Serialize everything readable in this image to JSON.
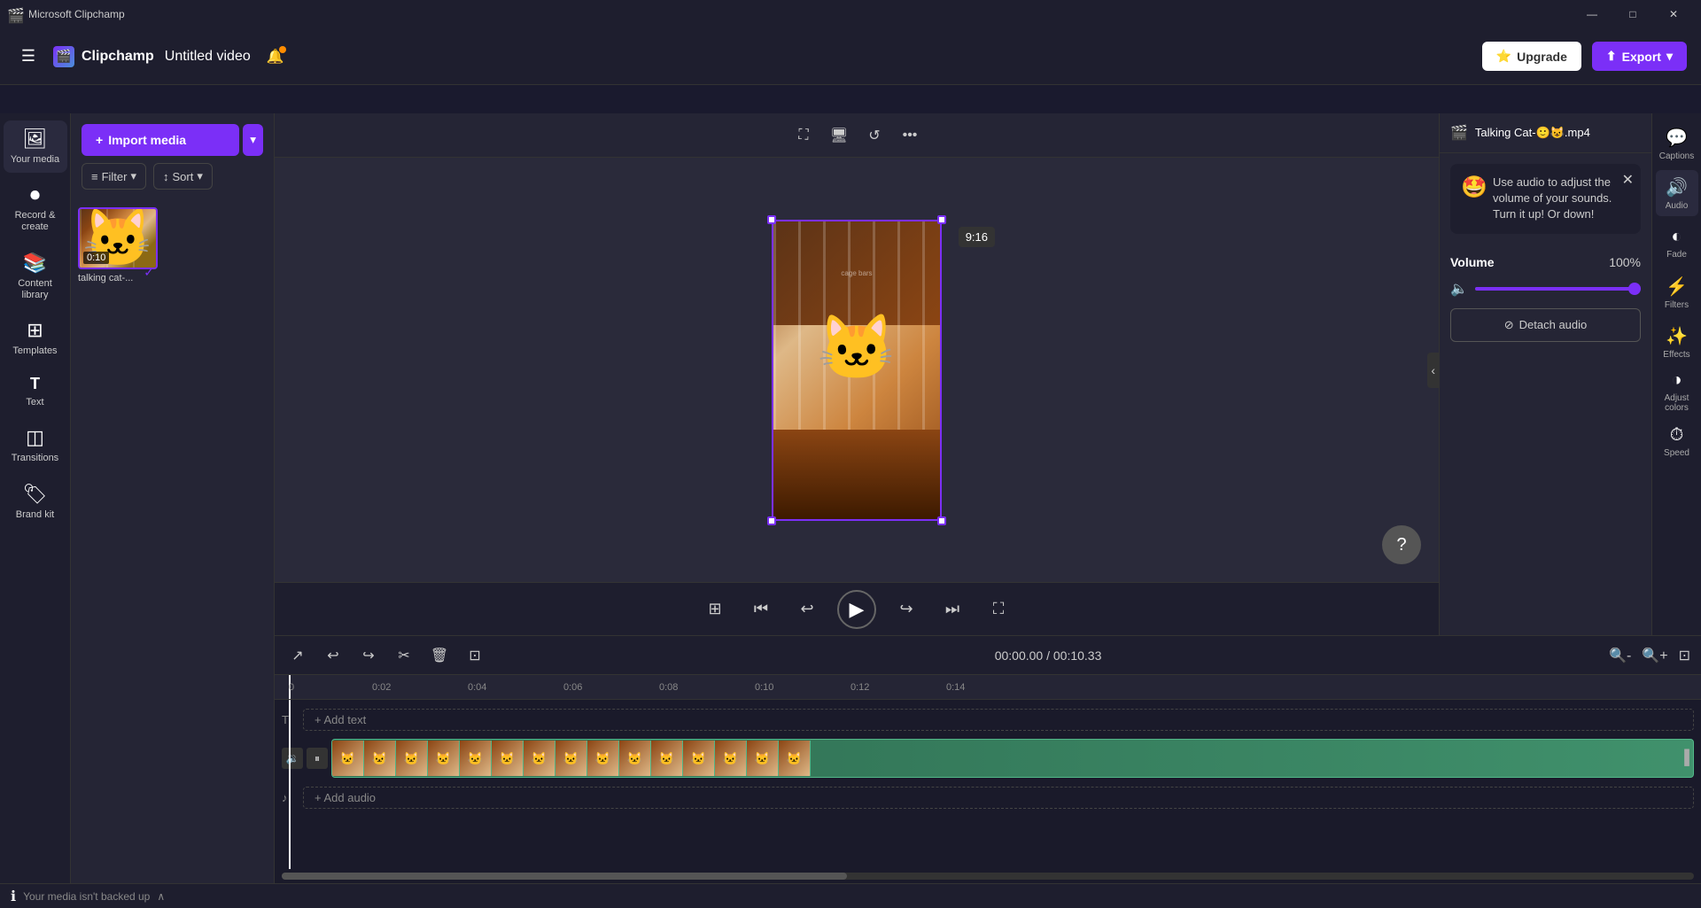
{
  "titlebar": {
    "title": "Microsoft Clipchamp",
    "controls": {
      "minimize": "—",
      "maximize": "□",
      "close": "✕"
    }
  },
  "topbar": {
    "brand_name": "Clipchamp",
    "video_title": "Untitled video",
    "upgrade_label": "Upgrade",
    "export_label": "Export"
  },
  "sidebar": {
    "items": [
      {
        "id": "your-media",
        "icon": "🖼",
        "label": "Your media"
      },
      {
        "id": "record-create",
        "icon": "⏺",
        "label": "Record & create"
      },
      {
        "id": "content-library",
        "icon": "📚",
        "label": "Content library"
      },
      {
        "id": "templates",
        "icon": "⊞",
        "label": "Templates"
      },
      {
        "id": "text",
        "icon": "T",
        "label": "Text"
      },
      {
        "id": "transitions",
        "icon": "◫",
        "label": "Transitions"
      },
      {
        "id": "brand-kit",
        "icon": "🏷",
        "label": "Brand kit"
      }
    ]
  },
  "media_panel": {
    "import_label": "Import media",
    "filter_label": "Filter",
    "sort_label": "Sort",
    "items": [
      {
        "name": "talking cat-...",
        "duration": "0:10",
        "selected": true
      }
    ]
  },
  "canvas": {
    "aspect_ratio": "9:16",
    "toolbar_tools": [
      "crop",
      "screen-record",
      "rotate",
      "more"
    ]
  },
  "timeline": {
    "current_time": "00:00.00",
    "total_time": "00:10.33",
    "add_text_label": "+ Add text",
    "add_audio_label": "+ Add audio",
    "ruler_marks": [
      "0:02",
      "0:04",
      "0:06",
      "0:08",
      "0:10",
      "0:12",
      "0:14"
    ]
  },
  "right_panel": {
    "file_name": "Talking Cat-🙂😺.mp4",
    "tooltip": {
      "emoji": "🤩",
      "text": "Use audio to adjust the volume of your sounds. Turn it up! Or down!"
    },
    "volume": {
      "label": "Volume",
      "value": "100%",
      "percentage": 100
    },
    "detach_audio_label": "Detach audio"
  },
  "right_icons": [
    {
      "id": "captions",
      "icon": "💬",
      "label": "Captions"
    },
    {
      "id": "audio",
      "icon": "🔊",
      "label": "Audio"
    },
    {
      "id": "fade",
      "icon": "◐",
      "label": "Fade"
    },
    {
      "id": "filters",
      "icon": "⚡",
      "label": "Filters"
    },
    {
      "id": "effects",
      "icon": "✨",
      "label": "Effects"
    },
    {
      "id": "adjust-colors",
      "icon": "◑",
      "label": "Adjust colors"
    },
    {
      "id": "speed",
      "icon": "⏱",
      "label": "Speed"
    }
  ],
  "status_bar": {
    "text": "Your media isn't backed up"
  }
}
